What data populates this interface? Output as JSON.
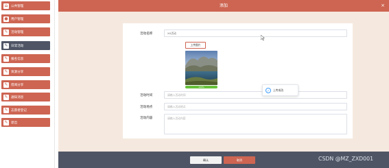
{
  "sidebar": {
    "items": [
      {
        "label": "公共管理",
        "icon": "home-icon"
      },
      {
        "label": "用户管理",
        "icon": "user-icon"
      },
      {
        "label": "活动管理",
        "icon": "edit-icon"
      },
      {
        "label": "日常活动",
        "icon": "edit-icon",
        "active": true
      },
      {
        "label": "报名信息",
        "icon": "edit-icon"
      },
      {
        "label": "资源分享",
        "icon": "edit-icon"
      },
      {
        "label": "借阅分享",
        "icon": "edit-icon"
      },
      {
        "label": "通知消息",
        "icon": "edit-icon"
      },
      {
        "label": "志愿者登记",
        "icon": "edit-icon"
      },
      {
        "label": "退出",
        "icon": "edit-icon"
      }
    ]
  },
  "dialog": {
    "title": "添加",
    "close_label": "×"
  },
  "form": {
    "name_label": "活动名称",
    "name_value": "XX活动",
    "upload_label": "上传图片",
    "upload_progress_percent": 100,
    "upload_progress_text": "100%",
    "time_label": "活动时间",
    "time_placeholder": "请输入活动时间",
    "place_label": "活动地点",
    "place_placeholder": "请输入活动地点",
    "content_label": "活动内容",
    "content_placeholder": "请输入活动内容"
  },
  "toast": {
    "text": "上传成功"
  },
  "footer": {
    "confirm_label": "确认",
    "cancel_label": "取消"
  },
  "watermark": "CSDN @MZ_ZXD001",
  "colors": {
    "accent": "#cd6552",
    "dark": "#4f5565",
    "panel_bg": "#f5e9df",
    "success": "#67c23a",
    "info": "#409eff"
  }
}
